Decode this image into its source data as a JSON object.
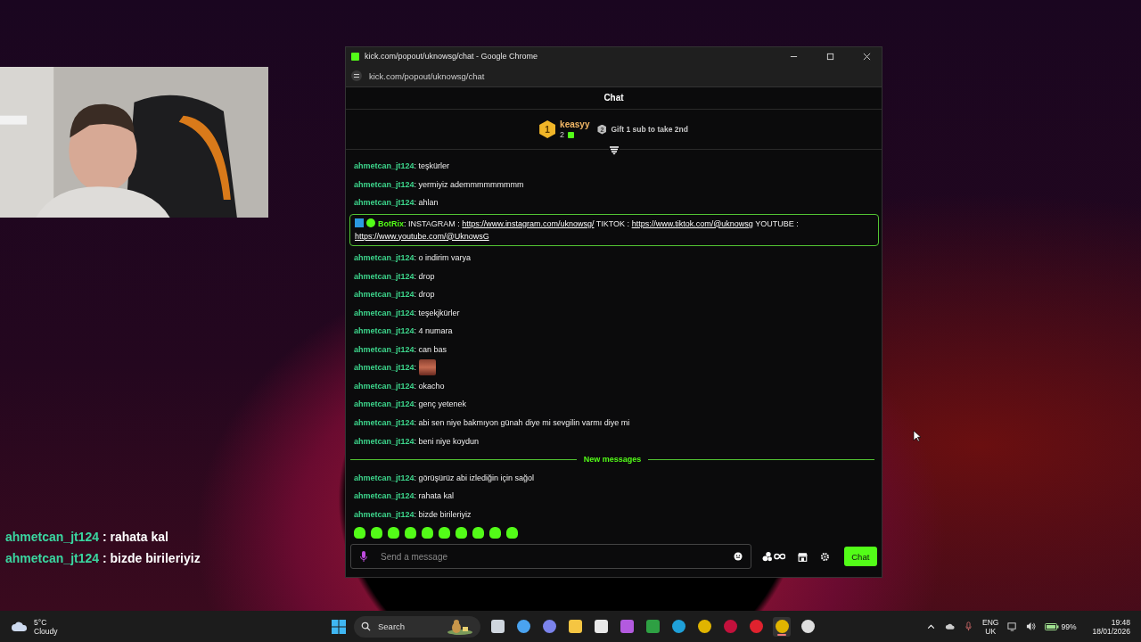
{
  "window": {
    "title": "kick.com/popout/uknowsg/chat - Google Chrome",
    "url": "kick.com/popout/uknowsg/chat"
  },
  "chat": {
    "header": "Chat",
    "leader": {
      "rank": "1",
      "name": "keasyy",
      "count": "2",
      "next_rank": "2",
      "hint": "Gift 1 sub to take 2nd"
    },
    "messages": [
      {
        "kind": "message",
        "user": "ahmetcan_jt124",
        "text": ": teşkürler"
      },
      {
        "kind": "message",
        "user": "ahmetcan_jt124",
        "text": ": yermiyiz ademmmmmmmmm"
      },
      {
        "kind": "message",
        "user": "ahmetcan_jt124",
        "text": ": ahlan"
      },
      {
        "kind": "bot",
        "user": "BotRix",
        "parts": [
          {
            "text": ": INSTAGRAM :"
          },
          {
            "link": "https://www.instagram.com/uknowsg/"
          },
          {
            "text": "TIKTOK :"
          },
          {
            "link": "https://www.tiktok.com/@uknowsg"
          },
          {
            "text": "YOUTUBE :"
          },
          {
            "link": "https://www.youtube.com/@UknowsG"
          }
        ]
      },
      {
        "kind": "message",
        "user": "ahmetcan_jt124",
        "text": ": o indirim varya"
      },
      {
        "kind": "message",
        "user": "ahmetcan_jt124",
        "text": ": drop"
      },
      {
        "kind": "message",
        "user": "ahmetcan_jt124",
        "text": ": drop"
      },
      {
        "kind": "message",
        "user": "ahmetcan_jt124",
        "text": ": teşekjkürler"
      },
      {
        "kind": "message",
        "user": "ahmetcan_jt124",
        "text": ": 4 numara"
      },
      {
        "kind": "message",
        "user": "ahmetcan_jt124",
        "text": ": can bas"
      },
      {
        "kind": "emote",
        "user": "ahmetcan_jt124",
        "text": ":"
      },
      {
        "kind": "message",
        "user": "ahmetcan_jt124",
        "text": ": okacho"
      },
      {
        "kind": "message",
        "user": "ahmetcan_jt124",
        "text": ": genç yetenek"
      },
      {
        "kind": "message",
        "user": "ahmetcan_jt124",
        "text": ": abi sen niye bakmıyon günah diye mi sevgilin varmı diye mi"
      },
      {
        "kind": "message",
        "user": "ahmetcan_jt124",
        "text": ": beni niye koydun"
      },
      {
        "kind": "divider",
        "text": "New messages"
      },
      {
        "kind": "message",
        "user": "ahmetcan_jt124",
        "text": ": görüşürüz abi izlediğin için sağol"
      },
      {
        "kind": "message",
        "user": "ahmetcan_jt124",
        "text": ": rahata kal"
      },
      {
        "kind": "message",
        "user": "ahmetcan_jt124",
        "text": ": bizde birileriyiz"
      }
    ],
    "input": {
      "placeholder": "Send a message"
    },
    "send_button": "Chat"
  },
  "overlay_messages": [
    {
      "user": "ahmetcan_jt124",
      "text": ": rahata kal"
    },
    {
      "user": "ahmetcan_jt124",
      "text": ": bizde birileriyiz"
    }
  ],
  "taskbar": {
    "weather": {
      "temp": "5°C",
      "condition": "Cloudy"
    },
    "search": {
      "placeholder": "Search"
    },
    "apps": [
      {
        "kind": "taskview",
        "active": false
      },
      {
        "kind": "copilot",
        "active": false
      },
      {
        "kind": "teams",
        "active": false
      },
      {
        "kind": "folder",
        "active": false
      },
      {
        "kind": "store",
        "active": false
      },
      {
        "kind": "photos",
        "active": false
      },
      {
        "kind": "xbox",
        "active": false
      },
      {
        "kind": "edge",
        "active": false
      },
      {
        "kind": "chrome",
        "active": false
      },
      {
        "kind": "operagx",
        "active": false
      },
      {
        "kind": "opera",
        "active": false
      },
      {
        "kind": "chrome",
        "active": true
      },
      {
        "kind": "obs",
        "active": false
      }
    ],
    "language": "ENG",
    "region": "UK",
    "battery": "99%",
    "time": "19:48",
    "date": "18/01/2026"
  }
}
